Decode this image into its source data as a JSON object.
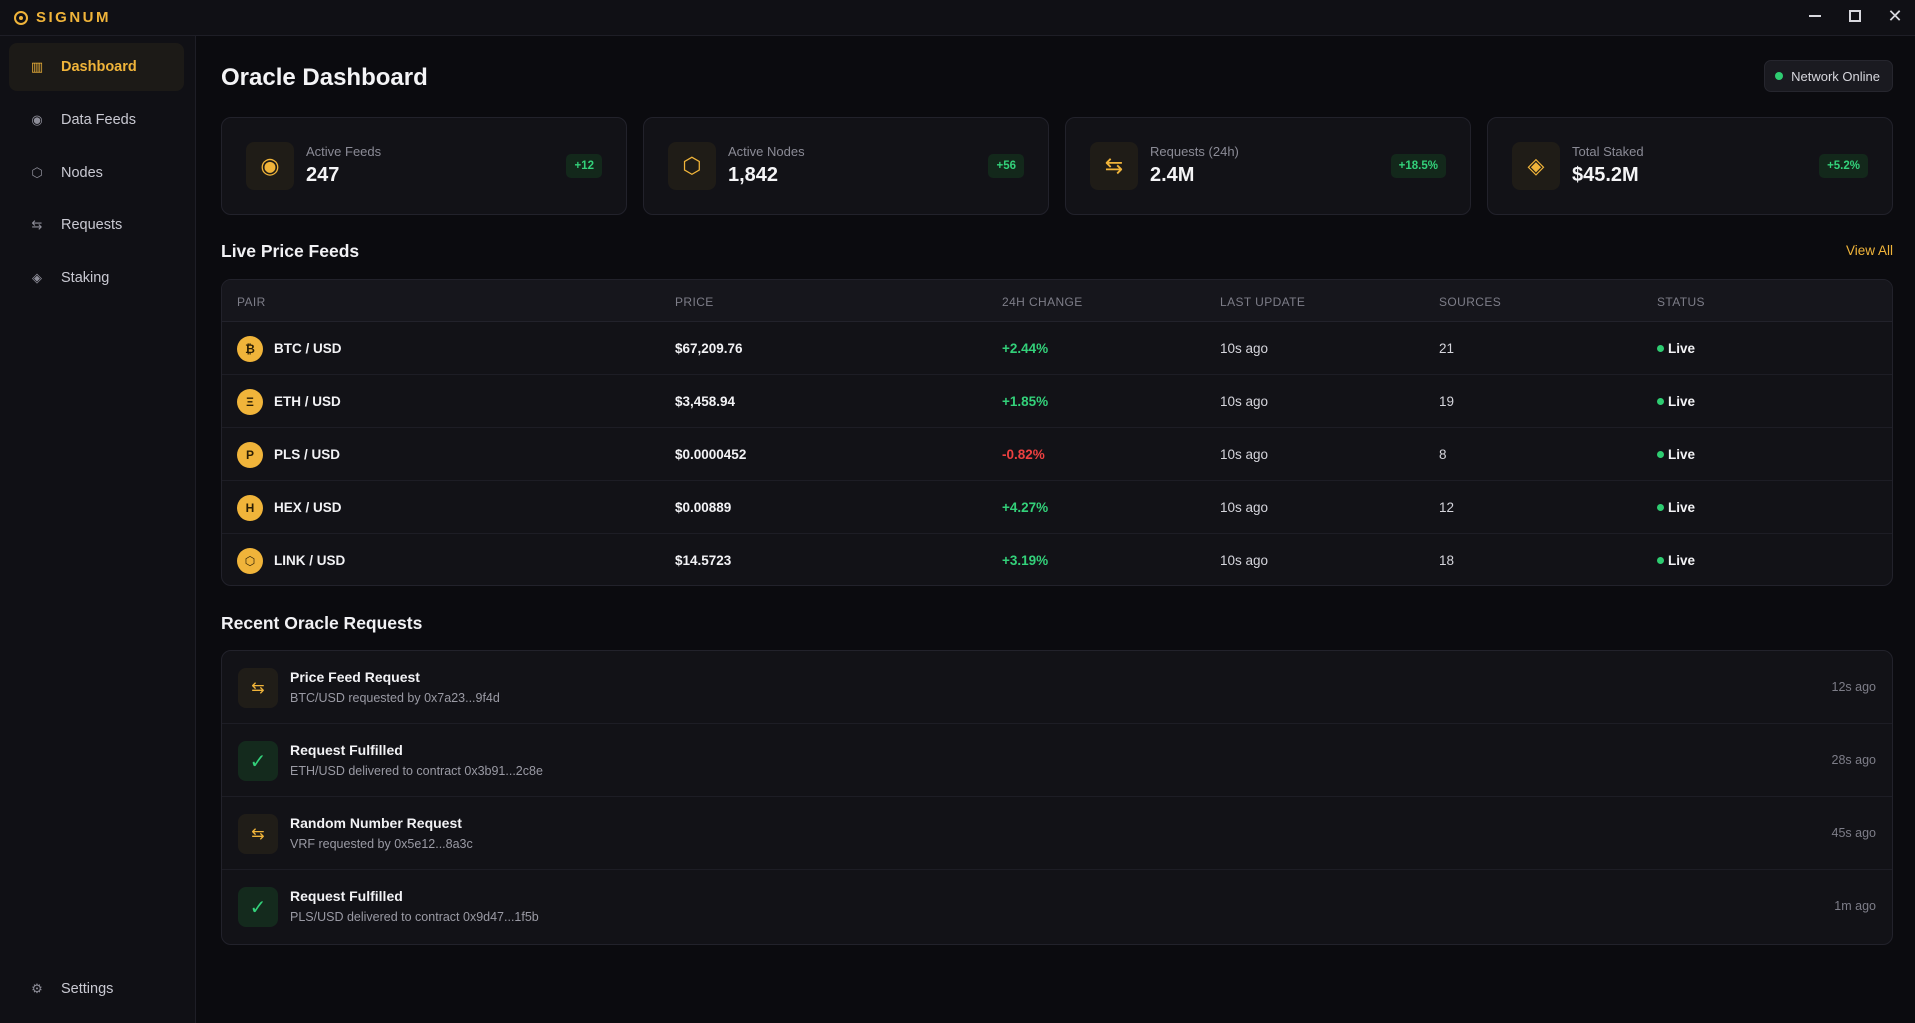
{
  "app": {
    "name": "SIGNUM"
  },
  "window": {
    "minimize": "—",
    "maximize": "☐",
    "close": "✕"
  },
  "sidebar": {
    "items": [
      {
        "label": "Dashboard",
        "icon": "columns-icon",
        "glyph": "▥",
        "active": true
      },
      {
        "label": "Data Feeds",
        "icon": "target-icon",
        "glyph": "◉",
        "active": false
      },
      {
        "label": "Nodes",
        "icon": "hexagon-icon",
        "glyph": "⬡",
        "active": false
      },
      {
        "label": "Requests",
        "icon": "transfer-icon",
        "glyph": "⇆",
        "active": false
      },
      {
        "label": "Staking",
        "icon": "diamond-icon",
        "glyph": "◈",
        "active": false
      }
    ],
    "settings": {
      "label": "Settings",
      "icon": "gear-icon",
      "glyph": "⚙"
    }
  },
  "header": {
    "title": "Oracle Dashboard",
    "network_status": "Network Online"
  },
  "stats": [
    {
      "label": "Active Feeds",
      "value": "247",
      "badge": "+12",
      "icon": "target-icon",
      "glyph": "◉"
    },
    {
      "label": "Active Nodes",
      "value": "1,842",
      "badge": "+56",
      "icon": "hexagon-icon",
      "glyph": "⬡"
    },
    {
      "label": "Requests (24h)",
      "value": "2.4M",
      "badge": "+18.5%",
      "icon": "transfer-icon",
      "glyph": "⇆"
    },
    {
      "label": "Total Staked",
      "value": "$45.2M",
      "badge": "+5.2%",
      "icon": "diamond-icon",
      "glyph": "◈"
    }
  ],
  "feeds": {
    "title": "Live Price Feeds",
    "view_all": "View All",
    "columns": [
      "PAIR",
      "PRICE",
      "24H CHANGE",
      "LAST UPDATE",
      "SOURCES",
      "STATUS"
    ],
    "rows": [
      {
        "symbol": "₿",
        "pair": "BTC / USD",
        "price": "$67,209.76",
        "change": "+2.44%",
        "trend": "up",
        "updated": "10s ago",
        "sources": "21",
        "status": "Live"
      },
      {
        "symbol": "Ξ",
        "pair": "ETH / USD",
        "price": "$3,458.94",
        "change": "+1.85%",
        "trend": "up",
        "updated": "10s ago",
        "sources": "19",
        "status": "Live"
      },
      {
        "symbol": "P",
        "pair": "PLS / USD",
        "price": "$0.0000452",
        "change": "-0.82%",
        "trend": "down",
        "updated": "10s ago",
        "sources": "8",
        "status": "Live"
      },
      {
        "symbol": "H",
        "pair": "HEX / USD",
        "price": "$0.00889",
        "change": "+4.27%",
        "trend": "up",
        "updated": "10s ago",
        "sources": "12",
        "status": "Live"
      },
      {
        "symbol": "⬡",
        "pair": "LINK / USD",
        "price": "$14.5723",
        "change": "+3.19%",
        "trend": "up",
        "updated": "10s ago",
        "sources": "18",
        "status": "Live"
      }
    ]
  },
  "requests": {
    "title": "Recent Oracle Requests",
    "items": [
      {
        "type": "pending",
        "icon": "transfer-icon",
        "glyph": "⇆",
        "title": "Price Feed Request",
        "detail": "BTC/USD requested by 0x7a23...9f4d",
        "time": "12s ago"
      },
      {
        "type": "done",
        "icon": "check-icon",
        "glyph": "✓",
        "title": "Request Fulfilled",
        "detail": "ETH/USD delivered to contract 0x3b91...2c8e",
        "time": "28s ago"
      },
      {
        "type": "pending",
        "icon": "transfer-icon",
        "glyph": "⇆",
        "title": "Random Number Request",
        "detail": "VRF requested by 0x5e12...8a3c",
        "time": "45s ago"
      },
      {
        "type": "done",
        "icon": "check-icon",
        "glyph": "✓",
        "title": "Request Fulfilled",
        "detail": "PLS/USD delivered to contract 0x9d47...1f5b",
        "time": "1m ago"
      }
    ]
  },
  "colors": {
    "accent": "#f0b43a",
    "positive": "#33d17a",
    "negative": "#ee4040",
    "background": "#0b0b0f"
  }
}
